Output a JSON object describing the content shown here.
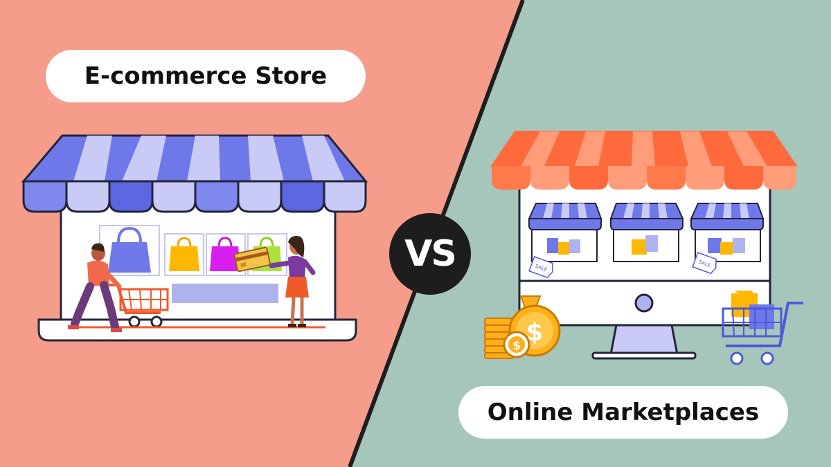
{
  "left_panel": {
    "title": "E-commerce Store",
    "bg": "#f59c8b"
  },
  "right_panel": {
    "title": "Online Marketplaces",
    "bg": "#a6c5bb"
  },
  "badge": {
    "text": "VS",
    "bg": "#1d1d1d"
  },
  "sale_tags": [
    "SALE",
    "SALE"
  ],
  "icons": [
    "storefront-icon",
    "shopper-man-icon",
    "shopper-woman-icon",
    "shopping-cart-icon",
    "shopping-bag-icon",
    "credit-card-icon",
    "monitor-icon",
    "money-bag-icon",
    "coin-stack-icon",
    "sale-tag-icon"
  ],
  "colors": {
    "awning_blue": "#6f78e8",
    "awning_orange": "#ff6a3d",
    "coin_gold": "#ffaf1a",
    "outline": "#23233a"
  }
}
